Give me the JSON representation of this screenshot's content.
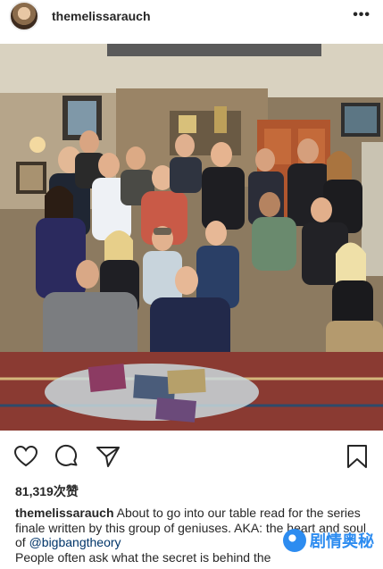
{
  "post": {
    "username": "themelissarauch",
    "more_glyph": "•••",
    "likes": "81,319次赞",
    "caption": {
      "username": "themelissarauch",
      "text_part1": " About to go into our table read for the series finale written by this group of geniuses. AKA: the heart and soul of ",
      "mention": "@bigbangtheory",
      "text_part2": " People often ask what the secret is behind the"
    }
  },
  "icons": {
    "heart": "heart-icon",
    "comment": "comment-icon",
    "share": "share-icon",
    "save": "bookmark-icon"
  },
  "watermark": {
    "text": "剧情奥秘"
  },
  "colors": {
    "text": "#262626",
    "mention": "#003569",
    "watermark": "#2d8cf0"
  }
}
